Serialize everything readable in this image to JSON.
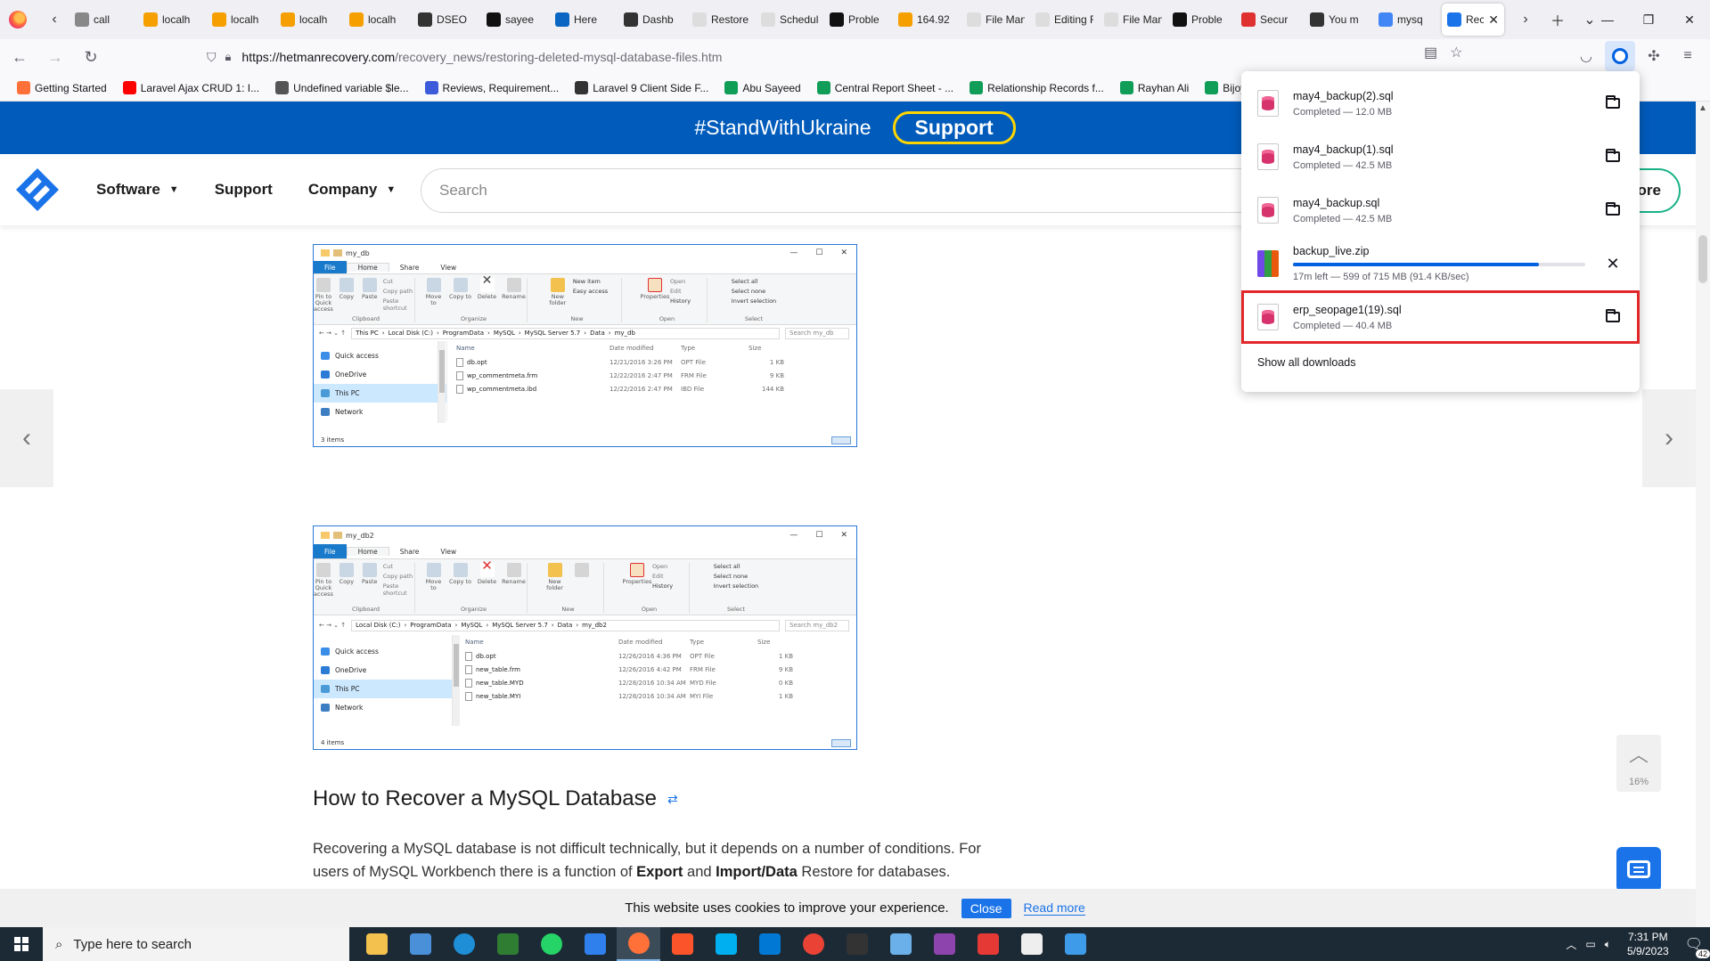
{
  "browser": {
    "tabs": [
      {
        "title": "call",
        "color": "#888888"
      },
      {
        "title": "localh",
        "color": "#f59f00"
      },
      {
        "title": "localh",
        "color": "#f59f00"
      },
      {
        "title": "localh",
        "color": "#f59f00"
      },
      {
        "title": "localh",
        "color": "#f59f00"
      },
      {
        "title": "DSEO",
        "color": "#333333"
      },
      {
        "title": "sayee",
        "color": "#111111"
      },
      {
        "title": "Here",
        "color": "#0a66c2"
      },
      {
        "title": "Dashb",
        "color": "#333333"
      },
      {
        "title": "Restore W",
        "color": "#dddddd"
      },
      {
        "title": "Schedule",
        "color": "#dddddd"
      },
      {
        "title": "Proble",
        "color": "#111111"
      },
      {
        "title": "164.92",
        "color": "#f59f00"
      },
      {
        "title": "File Mana",
        "color": "#dddddd"
      },
      {
        "title": "Editing Fil",
        "color": "#dddddd"
      },
      {
        "title": "File Mana",
        "color": "#dddddd"
      },
      {
        "title": "Proble",
        "color": "#111111"
      },
      {
        "title": "Secur",
        "color": "#e03131"
      },
      {
        "title": "You m",
        "color": "#333333"
      },
      {
        "title": "mysq",
        "color": "#4285f4"
      }
    ],
    "active_tab": {
      "title": "Rec"
    },
    "url_host": "https://hetmanrecovery.com",
    "url_path": "/recovery_news/restoring-deleted-mysql-database-files.htm",
    "bookmarks": [
      {
        "label": "Getting Started",
        "color": "#ff7139"
      },
      {
        "label": "Laravel Ajax CRUD 1: I...",
        "color": "#ff0000"
      },
      {
        "label": "Undefined variable $le...",
        "color": "#555555"
      },
      {
        "label": "Reviews, Requirement...",
        "color": "#3b5bdb"
      },
      {
        "label": "Laravel 9 Client Side F...",
        "color": "#333333"
      },
      {
        "label": "Abu Sayeed",
        "color": "#0f9d58"
      },
      {
        "label": "Central Report Sheet - ...",
        "color": "#0f9d58"
      },
      {
        "label": "Relationship Records f...",
        "color": "#0f9d58"
      },
      {
        "label": "Rayhan Ali",
        "color": "#0f9d58"
      },
      {
        "label": "Bijoy Karmokar",
        "color": "#0f9d58"
      }
    ]
  },
  "site": {
    "banner_tag": "#StandWithUkraine",
    "banner_support": "Support",
    "menu": [
      {
        "label": "Software",
        "caret": true
      },
      {
        "label": "Support",
        "caret": false
      },
      {
        "label": "Company",
        "caret": true
      }
    ],
    "search_placeholder": "Search",
    "store_label": "ore"
  },
  "explorer1": {
    "title": "my_db",
    "tabs": [
      "File",
      "Home",
      "Share",
      "View"
    ],
    "ribbon": {
      "pin": "Pin to Quick access",
      "copy": "Copy",
      "paste": "Paste",
      "cut": "Cut",
      "copy_path": "Copy path",
      "paste_shortcut": "Paste shortcut",
      "clipboard": "Clipboard",
      "move_to": "Move to",
      "copy_to": "Copy to",
      "delete": "Delete",
      "rename": "Rename",
      "organize": "Organize",
      "new_folder": "New folder",
      "new_item": "New item",
      "easy_access": "Easy access",
      "new": "New",
      "properties": "Properties",
      "open": "Open",
      "edit": "Edit",
      "history": "History",
      "open_group": "Open",
      "select_all": "Select all",
      "select_none": "Select none",
      "invert": "Invert selection",
      "select": "Select"
    },
    "path": [
      "This PC",
      "Local Disk (C:)",
      "ProgramData",
      "MySQL",
      "MySQL Server 5.7",
      "Data",
      "my_db"
    ],
    "search": "Search my_db",
    "nav": [
      "Quick access",
      "OneDrive",
      "This PC",
      "Network"
    ],
    "columns": [
      "Name",
      "Date modified",
      "Type",
      "Size"
    ],
    "files": [
      {
        "name": "db.opt",
        "date": "12/21/2016 3:26 PM",
        "type": "OPT File",
        "size": "1 KB"
      },
      {
        "name": "wp_commentmeta.frm",
        "date": "12/22/2016 2:47 PM",
        "type": "FRM File",
        "size": "9 KB"
      },
      {
        "name": "wp_commentmeta.ibd",
        "date": "12/22/2016 2:47 PM",
        "type": "IBD File",
        "size": "144 KB"
      }
    ],
    "status": "3 items"
  },
  "explorer2": {
    "title": "my_db2",
    "tabs": [
      "File",
      "Home",
      "Share",
      "View"
    ],
    "path": [
      "Local Disk (C:)",
      "ProgramData",
      "MySQL",
      "MySQL Server 5.7",
      "Data",
      "my_db2"
    ],
    "search": "Search my_db2",
    "nav": [
      "Quick access",
      "OneDrive",
      "This PC",
      "Network"
    ],
    "columns": [
      "Name",
      "Date modified",
      "Type",
      "Size"
    ],
    "files": [
      {
        "name": "db.opt",
        "date": "12/26/2016 4:36 PM",
        "type": "OPT File",
        "size": "1 KB"
      },
      {
        "name": "new_table.frm",
        "date": "12/26/2016 4:42 PM",
        "type": "FRM File",
        "size": "9 KB"
      },
      {
        "name": "new_table.MYD",
        "date": "12/28/2016 10:34 AM",
        "type": "MYD File",
        "size": "0 KB"
      },
      {
        "name": "new_table.MYI",
        "date": "12/28/2016 10:34 AM",
        "type": "MYI File",
        "size": "1 KB"
      }
    ],
    "status": "4 items"
  },
  "article": {
    "heading": "How to Recover a MySQL Database",
    "p_start": "Recovering a MySQL database is not difficult technically, but it depends on a number of conditions. For users of MySQL Workbench there is a function of ",
    "p_b1": "Export",
    "p_mid": " and ",
    "p_b2": "Import/Data",
    "p_end": " Restore for databases."
  },
  "cookie": {
    "text": "This website uses cookies to improve your experience.",
    "close": "Close",
    "read_more": "Read more"
  },
  "scroll_top": {
    "percent": "16%"
  },
  "downloads": {
    "items": [
      {
        "name": "may4_backup(2).sql",
        "status": "Completed — 12.0 MB",
        "kind": "sql",
        "action": "folder"
      },
      {
        "name": "may4_backup(1).sql",
        "status": "Completed — 42.5 MB",
        "kind": "sql",
        "action": "folder"
      },
      {
        "name": "may4_backup.sql",
        "status": "Completed — 42.5 MB",
        "kind": "sql",
        "action": "folder"
      },
      {
        "name": "backup_live.zip",
        "status": "17m left — 599 of 715 MB (91.4 KB/sec)",
        "kind": "zip",
        "action": "cancel",
        "progress": 0.84
      },
      {
        "name": "erp_seopage1(19).sql",
        "status": "Completed — 40.4 MB",
        "kind": "sql",
        "action": "folder",
        "highlighted": true
      }
    ],
    "show_all": "Show all downloads"
  },
  "taskbar": {
    "search_placeholder": "Type here to search",
    "apps": [
      {
        "name": "file-explorer",
        "color": "#f2c14e"
      },
      {
        "name": "app-blue",
        "color": "#4a90d9"
      },
      {
        "name": "edge",
        "color": "#1e8fd6"
      },
      {
        "name": "app-green",
        "color": "#2e7d32"
      },
      {
        "name": "app-whatsapp",
        "color": "#25d366"
      },
      {
        "name": "vscode",
        "color": "#2f80ed"
      },
      {
        "name": "firefox",
        "color": "#ff7139"
      },
      {
        "name": "brave",
        "color": "#fb542b"
      },
      {
        "name": "skype",
        "color": "#00aff0"
      },
      {
        "name": "skype2",
        "color": "#0078d4"
      },
      {
        "name": "chrome",
        "color": "#ea4335"
      },
      {
        "name": "terminal",
        "color": "#333333"
      },
      {
        "name": "app-notes",
        "color": "#6bb0e8"
      },
      {
        "name": "winrar",
        "color": "#8e44ad"
      },
      {
        "name": "anydesk",
        "color": "#e53935"
      },
      {
        "name": "settings",
        "color": "#eeeeee"
      },
      {
        "name": "app-remote",
        "color": "#3d9be9"
      }
    ],
    "time": "7:31 PM",
    "date": "5/9/2023",
    "notifications": "42"
  }
}
